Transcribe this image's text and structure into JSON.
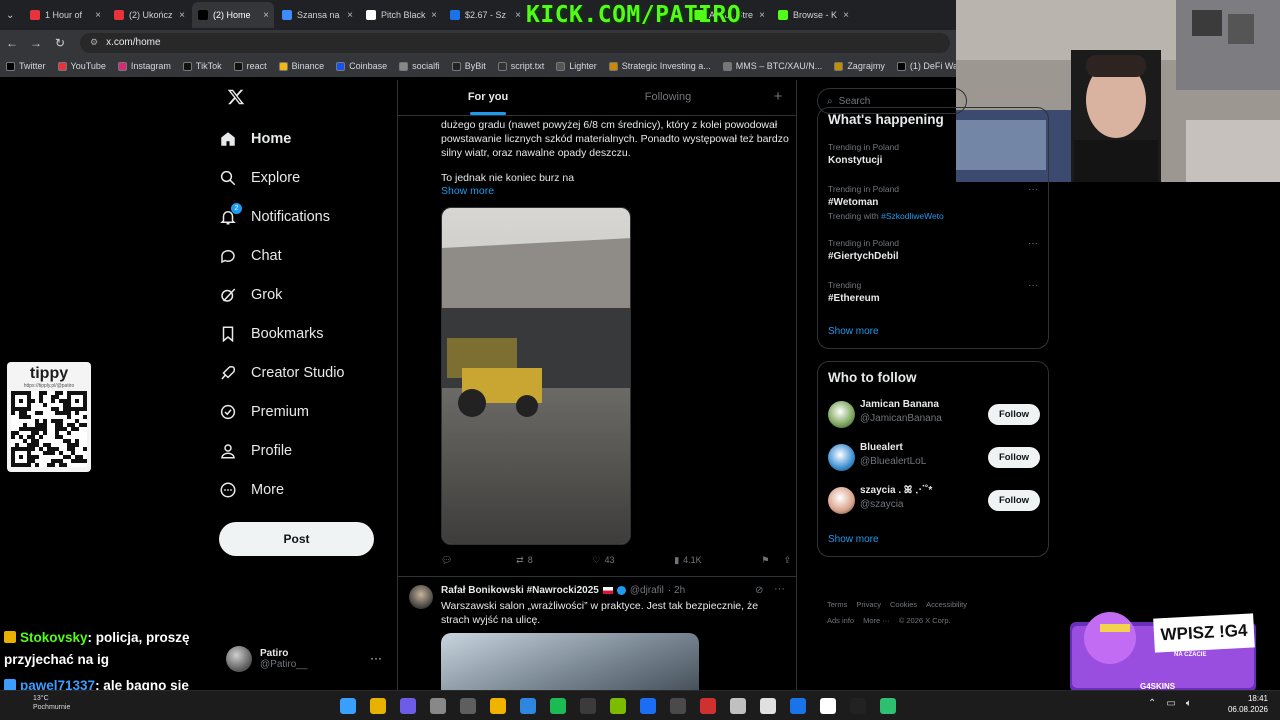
{
  "browser": {
    "tabs": [
      {
        "label": "1 Hour of",
        "color": "#e8323c",
        "icon": "youtube-icon"
      },
      {
        "label": "(2) Ukończ",
        "color": "#e8323c",
        "icon": "youtube-icon"
      },
      {
        "label": "(2) Home",
        "color": "#000000",
        "icon": "x-icon",
        "active": true
      },
      {
        "label": "Szansa na",
        "color": "#3f8cff",
        "icon": "globe-icon"
      },
      {
        "label": "Pitch Black",
        "color": "#ffffff",
        "icon": "page-icon"
      },
      {
        "label": "$2.67 - Sz",
        "color": "#1a73e8",
        "icon": "google-icon"
      },
      {
        "label": "Azdus Stre",
        "color": "#53fc18",
        "icon": "kick-icon"
      },
      {
        "label": "Browse - K",
        "color": "#53fc18",
        "icon": "kick-icon"
      }
    ],
    "url": "x.com/home",
    "bookmarks": [
      {
        "label": "Twitter",
        "color": "#000000"
      },
      {
        "label": "YouTube",
        "color": "#e8323c"
      },
      {
        "label": "Instagram",
        "color": "#d62976"
      },
      {
        "label": "TikTok",
        "color": "#111111"
      },
      {
        "label": "react",
        "color": "#111111"
      },
      {
        "label": "Binance",
        "color": "#f0b90b"
      },
      {
        "label": "Coinbase",
        "color": "#1652f0"
      },
      {
        "label": "socialfi",
        "color": "#888888"
      },
      {
        "label": "ByBit",
        "color": "#222222"
      },
      {
        "label": "script.txt",
        "color": "#333333"
      },
      {
        "label": "Lighter",
        "color": "#555555"
      },
      {
        "label": "Strategic Investing a...",
        "color": "#cc8800"
      },
      {
        "label": "MMS – BTC/XAU/N...",
        "color": "#777777"
      },
      {
        "label": "Zagrajmy",
        "color": "#c09000"
      },
      {
        "label": "(1) DeFi Warhol on...",
        "color": "#000000"
      }
    ]
  },
  "overlay": {
    "kick_text": "KICK.COM/PATIRO",
    "tippy_logo": "tippy",
    "tippy_url": "https://tipply.pl/@patiro",
    "chat": [
      {
        "user": "Stokovsky",
        "msg": ": policja, proszę",
        "msg2": "przyjechać na ig"
      },
      {
        "user": "pawel71337",
        "msg": ": ale bagno sie",
        "msg2": "zrobilo"
      }
    ],
    "promo_title": "WPISZ !G4",
    "promo_sub": "NA CZACIE",
    "promo_brand": "G4SKINS"
  },
  "nav": {
    "items": [
      {
        "label": "Home",
        "icon": "home-icon"
      },
      {
        "label": "Explore",
        "icon": "search-icon"
      },
      {
        "label": "Notifications",
        "icon": "bell-icon",
        "badge": "2"
      },
      {
        "label": "Chat",
        "icon": "chat-icon"
      },
      {
        "label": "Grok",
        "icon": "grok-icon"
      },
      {
        "label": "Bookmarks",
        "icon": "bookmark-icon"
      },
      {
        "label": "Creator Studio",
        "icon": "rocket-icon"
      },
      {
        "label": "Premium",
        "icon": "premium-icon"
      },
      {
        "label": "Profile",
        "icon": "person-icon"
      },
      {
        "label": "More",
        "icon": "more-icon"
      }
    ],
    "post_label": "Post",
    "account_name": "Patiro",
    "account_handle": "@Patiro__"
  },
  "feed": {
    "tab_foryou": "For you",
    "tab_following": "Following",
    "tweet1": {
      "text": "dużego gradu (nawet powyżej 6/8 cm średnicy), który z kolei powodował powstawanie licznych szkód materialnych. Ponadto występował też bardzo silny wiatr, oraz nawalne opady deszczu.",
      "text2": "To jednak nie koniec burz na",
      "show_more": "Show more",
      "replies": "",
      "reposts": "8",
      "likes": "43",
      "views": "4.1K"
    },
    "tweet2": {
      "name": "Rafał Bonikowski #Nawrocki2025",
      "handle": "@djrafil",
      "time": "· 2h",
      "text": "Warszawski salon „wrażliwości” w praktyce. Jest tak bezpiecznie, że strach wyjść na ulicę."
    }
  },
  "right": {
    "search_placeholder": "Search",
    "happening_title": "What's happening",
    "trends": [
      {
        "context": "Trending in Poland",
        "name": "Konstytucji",
        "with": ""
      },
      {
        "context": "Trending in Poland",
        "name": "#Wetoman",
        "with_prefix": "Trending with",
        "with": "#SzkodliweWeto"
      },
      {
        "context": "Trending in Poland",
        "name": "#GiertychDebil",
        "with": ""
      },
      {
        "context": "Trending",
        "name": "#Ethereum",
        "with": ""
      }
    ],
    "show_more": "Show more",
    "wtf_title": "Who to follow",
    "follow": [
      {
        "name": "Jamican Banana",
        "handle": "@JamicanBanana",
        "btn": "Follow",
        "color": "#7aa45a"
      },
      {
        "name": "Bluealert",
        "handle": "@BluealertLoL",
        "btn": "Follow",
        "color": "#3b8fd4"
      },
      {
        "name": "szaycia . ꕤ ⋰˚*",
        "handle": "@szaycia",
        "btn": "Follow",
        "color": "#d9a189"
      }
    ],
    "show_more2": "Show more",
    "footer": [
      "Terms",
      "Privacy",
      "Cookies",
      "Accessibility",
      "Ads info",
      "More ···",
      "© 2026 X Corp."
    ]
  },
  "taskbar": {
    "weather_temp": "13°C",
    "weather_desc": "Pochmurnie",
    "time": "18:41",
    "date": "06.08.2026"
  }
}
